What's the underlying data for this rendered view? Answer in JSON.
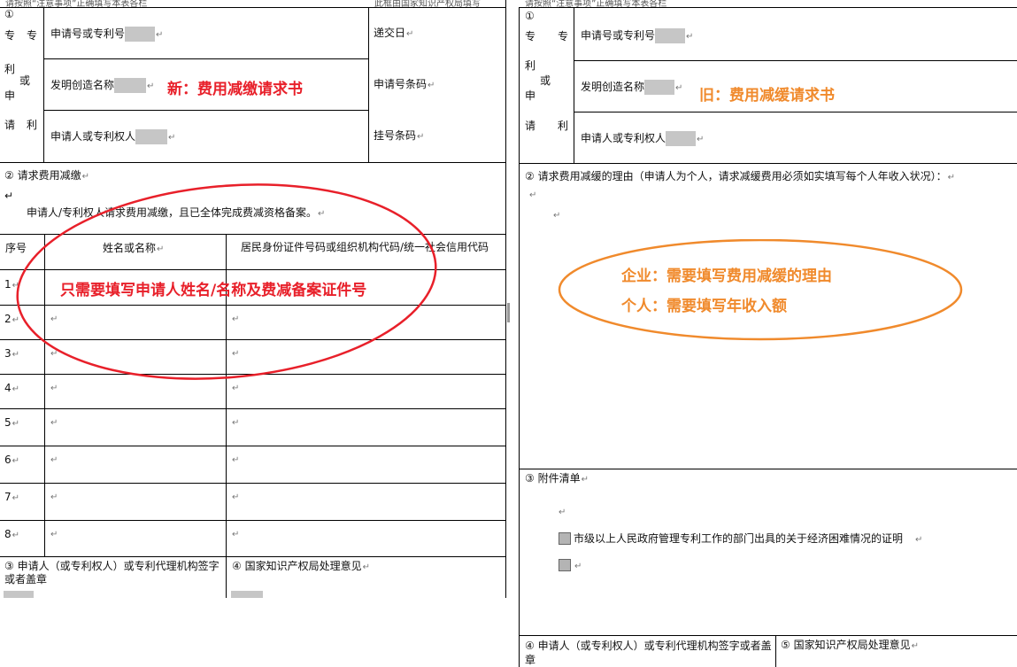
{
  "left": {
    "top_note": "请按照“注意事项”正确填写本表各栏",
    "top_note_right": "此框由国家知识产权局填写",
    "section1_number": "①",
    "vertical_label_chars": [
      "专",
      "专",
      "利",
      "或",
      "申",
      "请",
      "利"
    ],
    "applicant_number_label": "申请号或专利号",
    "invention_name_label": "发明创造名称",
    "applicant_label": "申请人或专利权人",
    "submit_date_label": "递交日",
    "barcode_label": "申请号条码",
    "registered_barcode_label": "挂号条码",
    "section2_title": "② 请求费用减缴",
    "section2_statement": "申请人/专利权人请求费用减缴，且已全体完成费减资格备案。",
    "table_headers": [
      "序号",
      "姓名或名称",
      "居民身份证件号码或组织机构代码/统一社会信用代码"
    ],
    "rows": [
      "1",
      "2",
      "3",
      "4",
      "5",
      "6",
      "7",
      "8"
    ],
    "section3_title": "③ 申请人（或专利权人）或专利代理机构签字或者盖章",
    "section4_title": "④ 国家知识产权局处理意见",
    "annotation_title": "新：费用减缴请求书",
    "annotation_circle": "只需要填写申请人姓名/名称及费减备案证件号"
  },
  "right": {
    "top_note": "请按照“注意事项”正确填写本表各栏",
    "section1_number": "①",
    "vertical_label_chars": [
      "专",
      "专",
      "利",
      "或",
      "申",
      "请",
      "利"
    ],
    "applicant_number_label": "申请号或专利号",
    "invention_name_label": "发明创造名称",
    "applicant_label": "申请人或专利权人",
    "section2_title": "② 请求费用减缓的理由（申请人为个人，请求减缓费用必须如实填写每个人年收入状况）：",
    "section3_title": "③ 附件清单",
    "attachment_1": "市级以上人民政府管理专利工作的部门出具的关于经济困难情况的证明",
    "section4_title": "④ 申请人（或专利权人）或专利代理机构签字或者盖章",
    "section5_title": "⑤ 国家知识产权局处理意见",
    "annotation_title": "旧：费用减缓请求书",
    "annotation_line1": "企业：需要填写费用减缓的理由",
    "annotation_line2": "个人：需要填写年收入额"
  },
  "colors": {
    "red_annotation": "#e8202a",
    "orange_annotation": "#f08a2c",
    "redaction_grey": "#c6c6c6"
  },
  "paragraph_mark": "↵"
}
